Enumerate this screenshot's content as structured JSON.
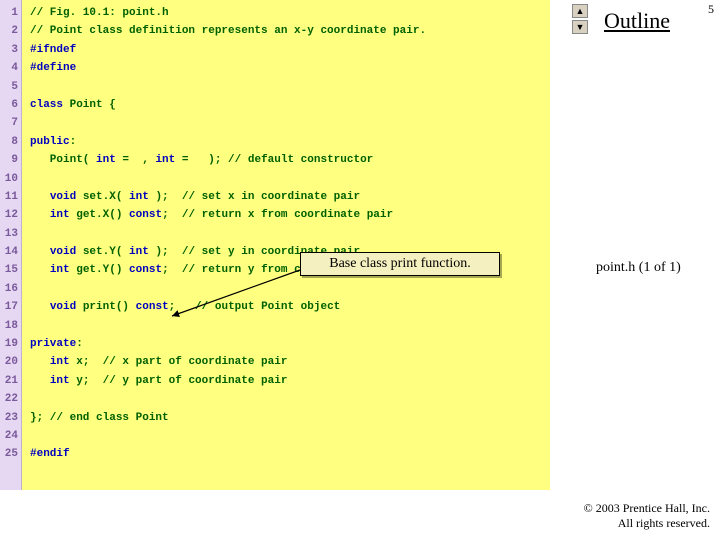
{
  "page_number": "5",
  "outline_title": "Outline",
  "caption": "point.h (1 of 1)",
  "copyright_line1": "© 2003 Prentice Hall, Inc.",
  "copyright_line2": "All rights reserved.",
  "callout_text": "Base class print function.",
  "nav": {
    "up": "▲",
    "down": "▼"
  },
  "lines": [
    {
      "n": "1",
      "t": "// Fig. 10.1: point.h"
    },
    {
      "n": "2",
      "t": "// Point class definition represents an x-y coordinate pair."
    },
    {
      "n": "3",
      "t": "#ifndef",
      "kw": true
    },
    {
      "n": "4",
      "t": "#define",
      "kw": true
    },
    {
      "n": "5",
      "t": ""
    },
    {
      "n": "6",
      "t": "class Point {",
      "pre_kw": "class ",
      "rest": "Point {"
    },
    {
      "n": "7",
      "t": ""
    },
    {
      "n": "8",
      "t": "public:",
      "pre_kw": "public",
      "rest": ":"
    },
    {
      "n": "9",
      "t": "   Point( int =  , int =   ); // default constructor",
      "pre_kw": "   Point( ",
      "kw1": "int",
      "mid1": " =  , ",
      "kw2": "int",
      "rest": " =   ); // default constructor"
    },
    {
      "n": "10",
      "t": ""
    },
    {
      "n": "11",
      "t": "   void set.X( int );  // set x in coordinate pair",
      "pre_kw": "   ",
      "kw1": "void",
      "mid1": " set.X( ",
      "kw2": "int",
      "rest": " );  // set x in coordinate pair"
    },
    {
      "n": "12",
      "t": "   int get.X() const;  // return x from coordinate pair",
      "pre_kw": "   ",
      "kw1": "int",
      "mid1": " get.X() ",
      "kw2": "const",
      "rest": ";  // return x from coordinate pair"
    },
    {
      "n": "13",
      "t": ""
    },
    {
      "n": "14",
      "t": "   void set.Y( int );  // set y in coordinate pair",
      "pre_kw": "   ",
      "kw1": "void",
      "mid1": " set.Y( ",
      "kw2": "int",
      "rest": " );  // set y in coordinate pair"
    },
    {
      "n": "15",
      "t": "   int get.Y() const;  // return y from coordinate pair",
      "pre_kw": "   ",
      "kw1": "int",
      "mid1": " get.Y() ",
      "kw2": "const",
      "rest": ";  // return y from coordinate pair"
    },
    {
      "n": "16",
      "t": ""
    },
    {
      "n": "17",
      "t": "   void print() const;   // output Point object",
      "pre_kw": "   ",
      "kw1": "void",
      "mid1": " print() ",
      "kw2": "const",
      "rest": ";   // output Point object"
    },
    {
      "n": "18",
      "t": ""
    },
    {
      "n": "19",
      "t": "private: ",
      "pre_kw": "private",
      "rest": ": "
    },
    {
      "n": "20",
      "t": "   int x;  // x part of coordinate pair",
      "pre_kw": "   ",
      "kw1": "int",
      "rest": " x;  // x part of coordinate pair"
    },
    {
      "n": "21",
      "t": "   int y;  // y part of coordinate pair",
      "pre_kw": "   ",
      "kw1": "int",
      "rest": " y;  // y part of coordinate pair"
    },
    {
      "n": "22",
      "t": ""
    },
    {
      "n": "23",
      "t": "}; // end class Point"
    },
    {
      "n": "24",
      "t": ""
    },
    {
      "n": "25",
      "t": "#endif",
      "kw": true
    }
  ]
}
